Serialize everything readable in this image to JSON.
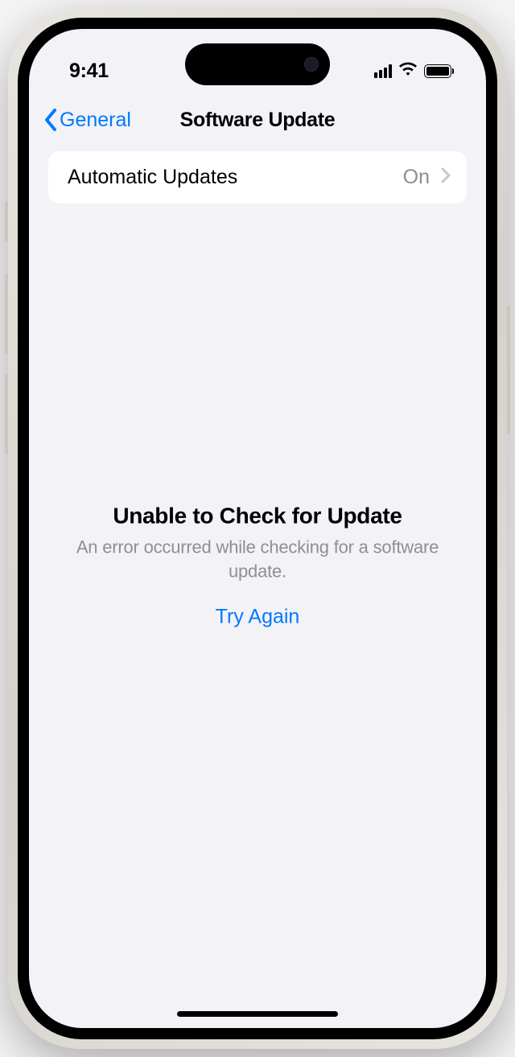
{
  "statusBar": {
    "time": "9:41"
  },
  "nav": {
    "backLabel": "General",
    "title": "Software Update"
  },
  "settings": {
    "automaticUpdates": {
      "label": "Automatic Updates",
      "value": "On"
    }
  },
  "error": {
    "title": "Unable to Check for Update",
    "message": "An error occurred while checking for a software update.",
    "actionLabel": "Try Again"
  }
}
